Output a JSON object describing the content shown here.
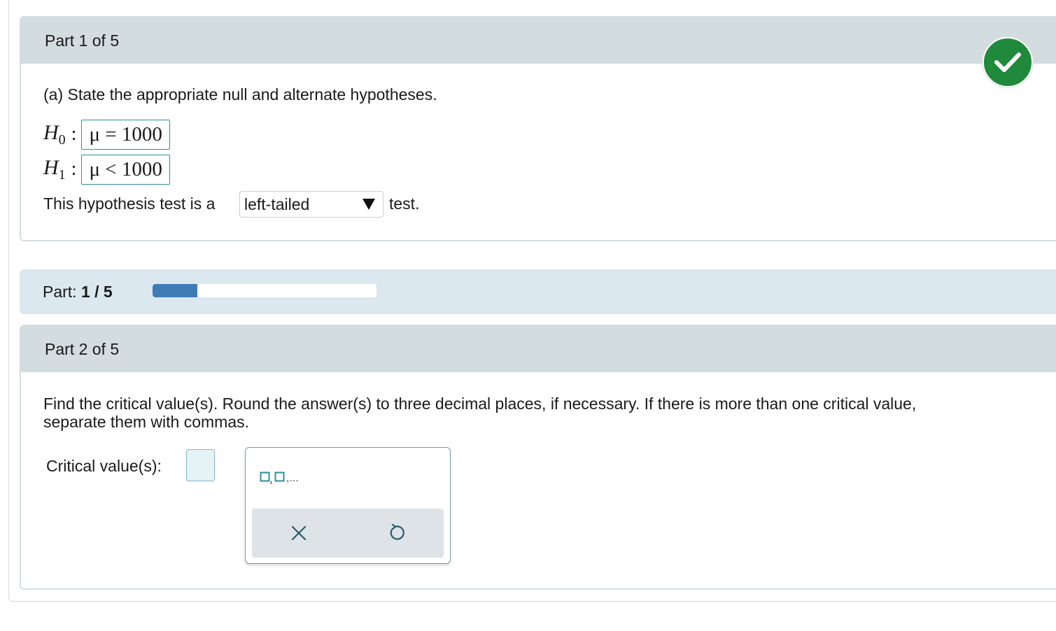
{
  "part1": {
    "header": "Part 1 of 5",
    "status_icon": "checkmark-icon",
    "question": "(a) State the appropriate null and alternate hypotheses.",
    "h0": {
      "label": "H",
      "sub": "0",
      "answer": "μ = 1000"
    },
    "h1": {
      "label": "H",
      "sub": "1",
      "answer": "μ < 1000"
    },
    "test_prefix": "This hypothesis test is a",
    "test_type_selected": "left-tailed",
    "test_suffix": "test."
  },
  "progress": {
    "label": "Part:",
    "value_text": "1 / 5",
    "fraction": 0.2
  },
  "part2": {
    "header": "Part 2 of 5",
    "instruction_line1": "Find the critical value(s). Round the answer(s) to three decimal places, if necessary. If there is more than one critical value,",
    "instruction_line2": "separate them with commas.",
    "cv_label": "Critical value(s):",
    "cv_value": "",
    "palette": {
      "list_button_suffix": ",...",
      "clear_icon": "close-icon",
      "undo_icon": "undo-icon"
    }
  },
  "colors": {
    "check_green": "#1f8a3b",
    "progress_blue": "#3f7bb5",
    "header_gray": "#d3dcdf",
    "strip_blue": "#dbe8ef"
  }
}
